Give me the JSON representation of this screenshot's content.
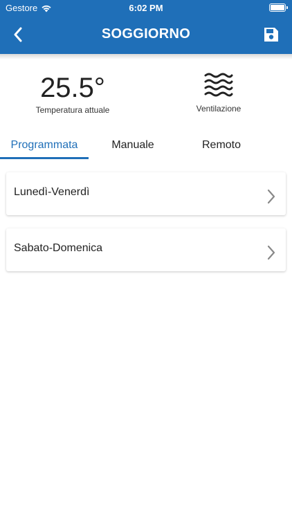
{
  "status_bar": {
    "carrier": "Gestore",
    "time": "6:02 PM"
  },
  "header": {
    "title": "SOGGIORNO"
  },
  "temperature": {
    "value": "25.5°",
    "label": "Temperatura attuale"
  },
  "ventilation": {
    "label": "Ventilazione"
  },
  "tabs": [
    {
      "label": "Programmata"
    },
    {
      "label": "Manuale"
    },
    {
      "label": "Remoto"
    }
  ],
  "schedules": [
    {
      "label": "Lunedì-Venerdì"
    },
    {
      "label": "Sabato-Domenica"
    }
  ],
  "colors": {
    "primary": "#1f6fb8",
    "chevron": "#888888"
  }
}
